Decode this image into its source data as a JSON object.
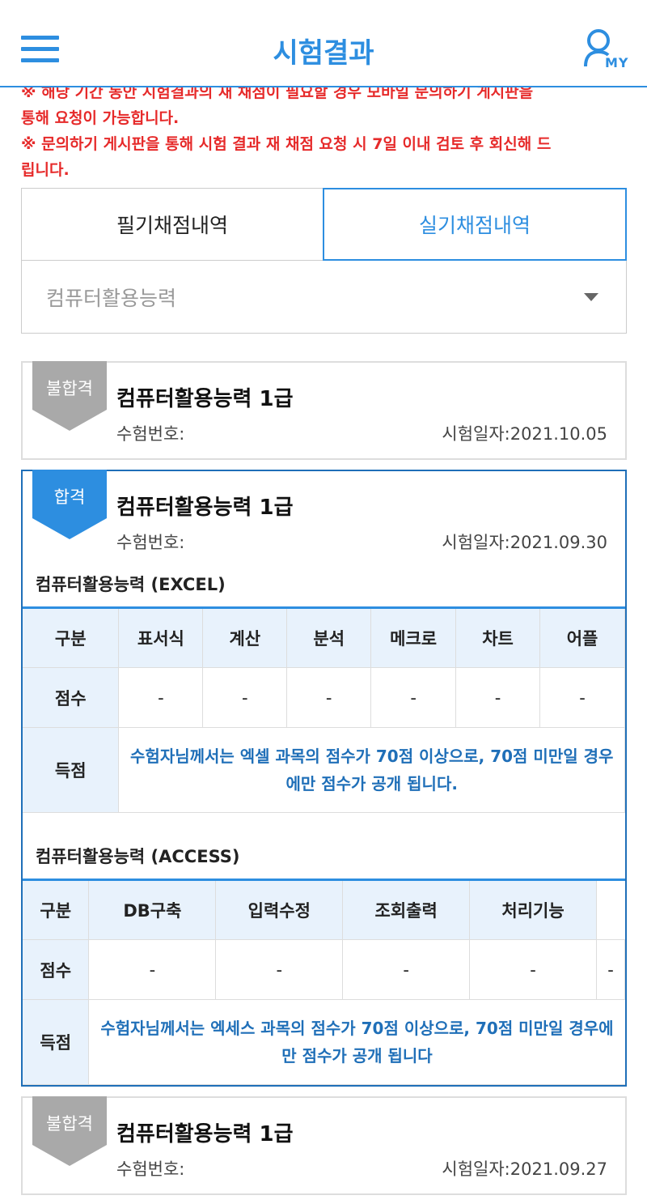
{
  "header": {
    "title": "시험결과",
    "my_label": "MY"
  },
  "notices": [
    "※ 해당 기간 동안 시험결과의 재 채점이 필요할 경우 모바일 문의하기 게시판을",
    "통해 요청이 가능합니다.",
    "※ 문의하기 게시판을 통해 시험 결과 재 채점 요청 시 7일 이내 검토 후 회신해 드",
    "립니다."
  ],
  "tabs": [
    {
      "label": "필기채점내역",
      "active": false
    },
    {
      "label": "실기채점내역",
      "active": true
    }
  ],
  "select": {
    "value": "컴퓨터활용능력"
  },
  "results": [
    {
      "status": "불합격",
      "status_color": "#a9a9a9",
      "title": "컴퓨터활용능력 1급",
      "exam_no_label": "수험번호:",
      "date_label": "시험일자:2021.10.05"
    },
    {
      "status": "합격",
      "status_color": "#2d8ee0",
      "title": "컴퓨터활용능력 1급",
      "exam_no_label": "수험번호:",
      "date_label": "시험일자:2021.09.30",
      "excel": {
        "title": "컴퓨터활용능력 (EXCEL)",
        "headers": [
          "구분",
          "표서식",
          "계산",
          "분석",
          "메크로",
          "차트",
          "어플"
        ],
        "scores": [
          "점수",
          "-",
          "-",
          "-",
          "-",
          "-",
          "-"
        ],
        "result_label": "득점",
        "result_note": "수험자님께서는 엑셀 과목의 점수가 70점 이상으로, 70점 미만일 경우에만 점수가 공개 됩니다."
      },
      "access": {
        "title": "컴퓨터활용능력 (ACCESS)",
        "headers": [
          "구분",
          "DB구축",
          "입력수정",
          "조회출력",
          "처리기능"
        ],
        "scores": [
          "점수",
          "-",
          "-",
          "-",
          "-",
          "-"
        ],
        "result_label": "득점",
        "result_note": "수험자님께서는 엑세스 과목의 점수가 70점 이상으로, 70점 미만일 경우에만 점수가 공개 됩니다"
      }
    },
    {
      "status": "불합격",
      "status_color": "#a9a9a9",
      "title": "컴퓨터활용능력 1급",
      "exam_no_label": "수험번호:",
      "date_label": "시험일자:2021.09.27"
    }
  ]
}
